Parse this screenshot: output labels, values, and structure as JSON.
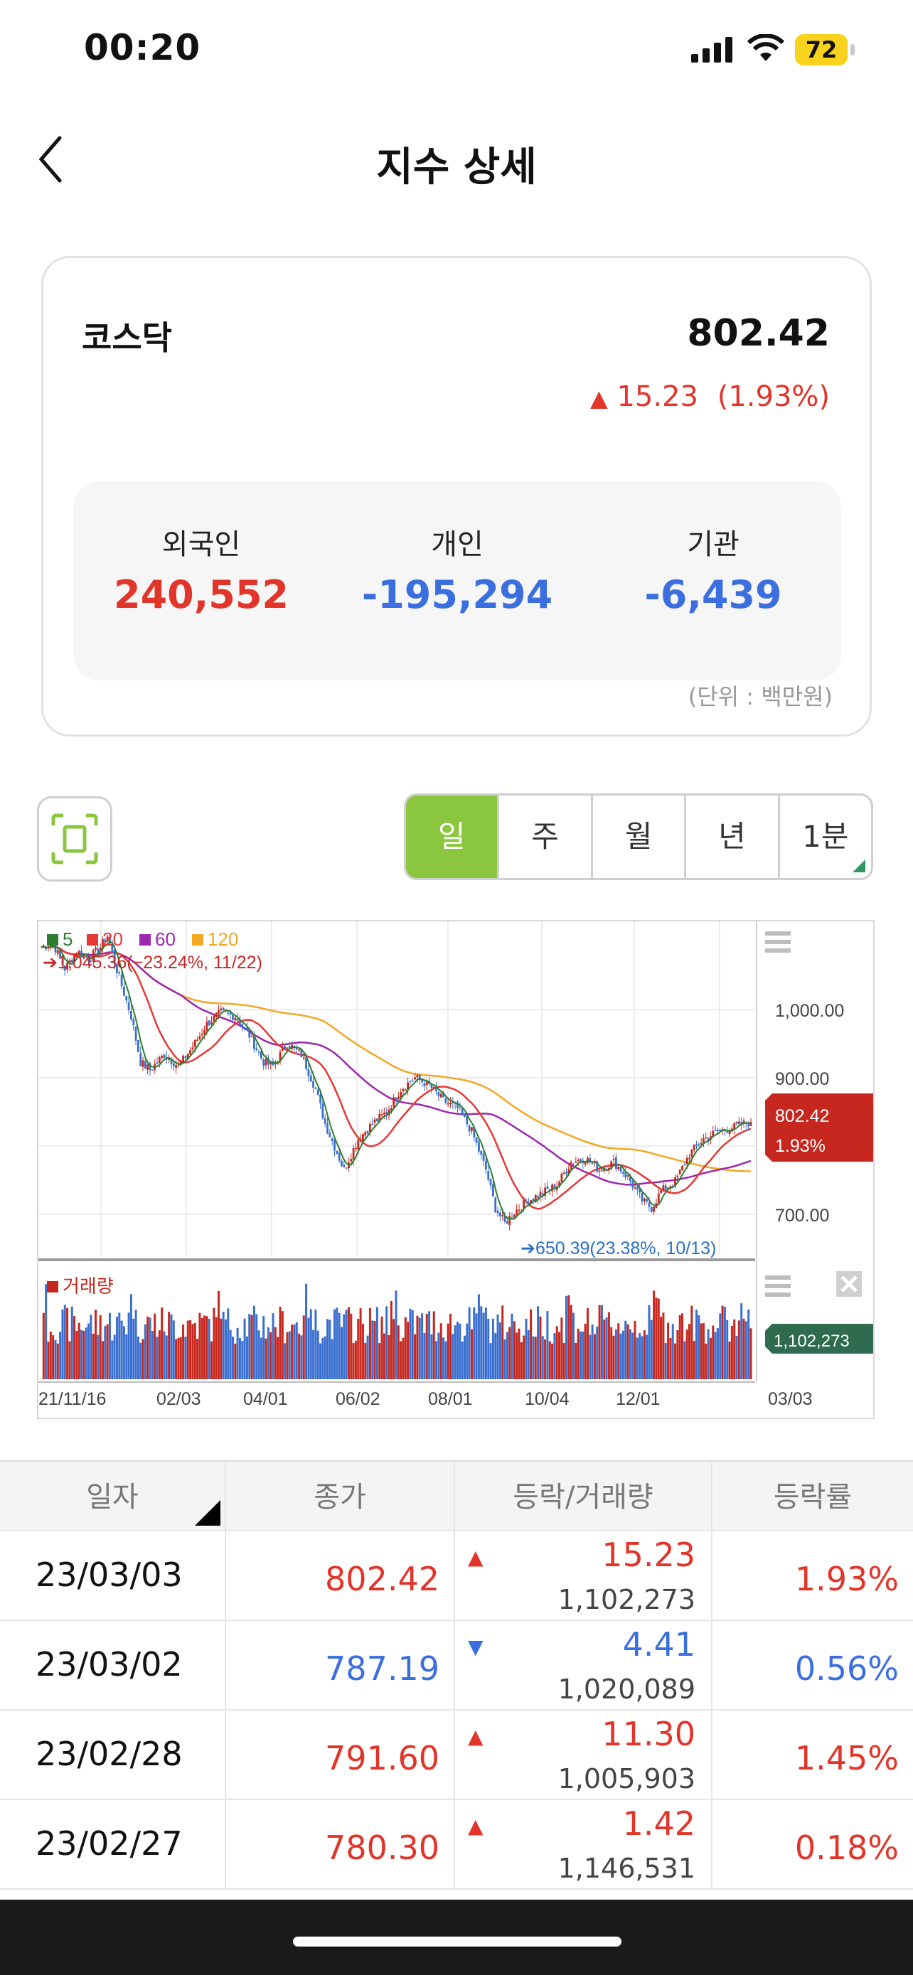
{
  "status": {
    "time": "00:20",
    "battery": "72"
  },
  "nav": {
    "title": "지수 상세",
    "back_icon": "chevron-left-icon"
  },
  "index": {
    "name": "코스닥",
    "value": "802.42",
    "change": "15.23",
    "rate": "(1.93%)",
    "direction": "up"
  },
  "investors": [
    {
      "label": "외국인",
      "value": "240,552",
      "color": "#e1352a"
    },
    {
      "label": "개인",
      "value": "-195,294",
      "color": "#3b6fe0"
    },
    {
      "label": "기관",
      "value": "-6,439",
      "color": "#3b6fe0"
    }
  ],
  "unit": "(단위 : 백만원)",
  "periods": [
    "일",
    "주",
    "월",
    "년",
    "1분"
  ],
  "selected_period": "일",
  "chart": {
    "legend": [
      {
        "label": "5",
        "color": "#2e7d32"
      },
      {
        "label": "20",
        "color": "#e53935"
      },
      {
        "label": "60",
        "color": "#9c27b0"
      },
      {
        "label": "120",
        "color": "#f5a623"
      }
    ],
    "high_note": "1,045.36(−23.24%, 11/22)",
    "low_note": "650.39(23.38%, 10/13)",
    "yticks": [
      "1,000.00",
      "900.00",
      "700.00"
    ],
    "price_badge": "802.42",
    "price_badge_rate": "1.93%",
    "volume_label": "거래량",
    "volume_badge": "1,102,273",
    "xticks": [
      "21/11/16",
      "02/03",
      "04/01",
      "06/02",
      "08/01",
      "10/04",
      "12/01",
      "03/03"
    ]
  },
  "chart_data": {
    "type": "candlestick",
    "ylim": [
      630,
      1060
    ],
    "ma_colors": {
      "5": "#2e7d32",
      "20": "#e53935",
      "60": "#9c27b0",
      "120": "#f5a623"
    },
    "close_trend": [
      [
        0,
        1030
      ],
      [
        5,
        1035
      ],
      [
        10,
        1002
      ],
      [
        15,
        1025
      ],
      [
        20,
        1015
      ],
      [
        25,
        1030
      ],
      [
        28,
        1045
      ],
      [
        32,
        1000
      ],
      [
        38,
        940
      ],
      [
        42,
        880
      ],
      [
        46,
        870
      ],
      [
        52,
        890
      ],
      [
        58,
        875
      ],
      [
        64,
        900
      ],
      [
        70,
        930
      ],
      [
        76,
        945
      ],
      [
        82,
        940
      ],
      [
        88,
        915
      ],
      [
        94,
        880
      ],
      [
        98,
        875
      ],
      [
        104,
        905
      ],
      [
        110,
        890
      ],
      [
        116,
        845
      ],
      [
        120,
        800
      ],
      [
        124,
        770
      ],
      [
        128,
        740
      ],
      [
        134,
        780
      ],
      [
        140,
        800
      ],
      [
        146,
        815
      ],
      [
        152,
        845
      ],
      [
        158,
        860
      ],
      [
        164,
        850
      ],
      [
        170,
        830
      ],
      [
        176,
        820
      ],
      [
        182,
        790
      ],
      [
        188,
        740
      ],
      [
        192,
        690
      ],
      [
        196,
        670
      ],
      [
        200,
        685
      ],
      [
        206,
        700
      ],
      [
        212,
        710
      ],
      [
        218,
        720
      ],
      [
        224,
        750
      ],
      [
        230,
        755
      ],
      [
        236,
        740
      ],
      [
        242,
        750
      ],
      [
        248,
        730
      ],
      [
        254,
        700
      ],
      [
        258,
        690
      ],
      [
        262,
        712
      ],
      [
        268,
        725
      ],
      [
        274,
        760
      ],
      [
        280,
        780
      ],
      [
        286,
        790
      ],
      [
        292,
        795
      ],
      [
        300,
        802.42
      ]
    ]
  },
  "table": {
    "headers": [
      "일자",
      "종가",
      "등락/거래량",
      "등락률"
    ],
    "rows": [
      {
        "date": "23/03/03",
        "close": "802.42",
        "dir": "▲",
        "change": "15.23",
        "volume": "1,102,273",
        "rate": "1.93%",
        "color": "#e1352a"
      },
      {
        "date": "23/03/02",
        "close": "787.19",
        "dir": "▼",
        "change": "4.41",
        "volume": "1,020,089",
        "rate": "0.56%",
        "color": "#3b6fe0"
      },
      {
        "date": "23/02/28",
        "close": "791.60",
        "dir": "▲",
        "change": "11.30",
        "volume": "1,005,903",
        "rate": "1.45%",
        "color": "#e1352a"
      },
      {
        "date": "23/02/27",
        "close": "780.30",
        "dir": "▲",
        "change": "1.42",
        "volume": "1,146,531",
        "rate": "0.18%",
        "color": "#e1352a"
      }
    ]
  }
}
